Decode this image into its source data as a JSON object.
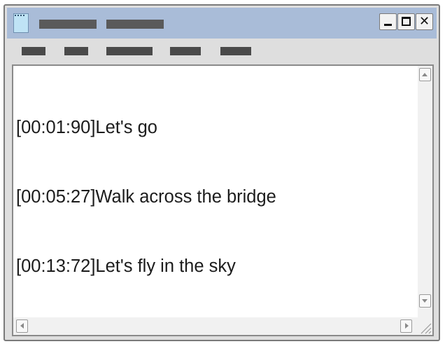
{
  "window": {
    "title_blocks": [
      "title-placeholder-1",
      "title-placeholder-2"
    ],
    "controls": {
      "minimize_icon": "minimize-icon",
      "maximize_icon": "maximize-icon",
      "close_label": "✕",
      "close_icon": "close-icon"
    },
    "app_icon": "notepad-icon",
    "colors": {
      "titlebar": "#a9bcd8",
      "frame": "#dedede",
      "redacted": "#4a4a4a"
    }
  },
  "menubar": {
    "items": [
      "menu-1",
      "menu-2",
      "menu-3",
      "menu-4",
      "menu-5"
    ]
  },
  "editor": {
    "lines": [
      "[00:01:90]Let's go",
      "[00:05:27]Walk across the bridge",
      "[00:13:72]Let's fly in the sky"
    ]
  },
  "scrollbars": {
    "icons": [
      "arrow-up-icon",
      "arrow-down-icon",
      "arrow-left-icon",
      "arrow-right-icon",
      "resize-grip-icon"
    ]
  }
}
